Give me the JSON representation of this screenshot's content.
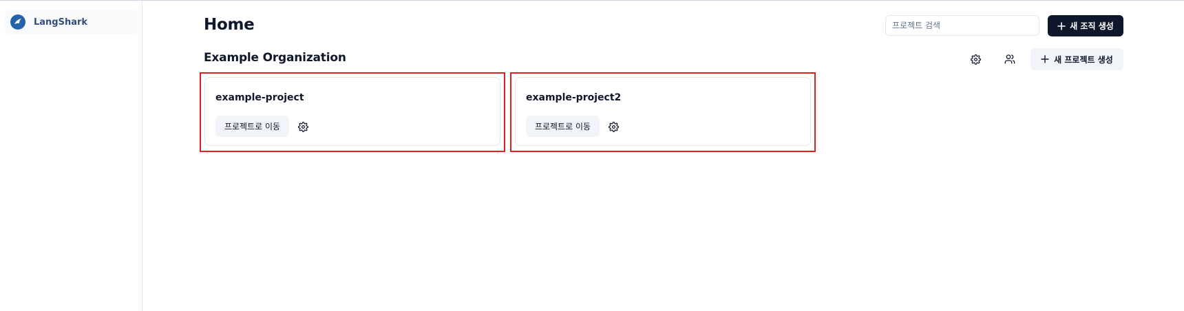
{
  "sidebar": {
    "brand": {
      "name": "LangShark",
      "icon": "shark-logo-icon"
    }
  },
  "header": {
    "title": "Home",
    "search": {
      "placeholder": "프로젝트 검색",
      "value": ""
    },
    "new_org_button": {
      "label": "새 조직 생성",
      "icon": "plus-icon"
    }
  },
  "organization": {
    "name": "Example Organization",
    "actions": {
      "settings_icon": "gear-icon",
      "members_icon": "users-icon",
      "new_project_button": {
        "label": "새 프로젝트 생성",
        "icon": "plus-icon"
      }
    },
    "projects": [
      {
        "name": "example-project",
        "go_label": "프로젝트로 이동",
        "settings_icon": "gear-icon"
      },
      {
        "name": "example-project2",
        "go_label": "프로젝트로 이동",
        "settings_icon": "gear-icon"
      }
    ]
  },
  "colors": {
    "primary": "#0f172a",
    "secondary_bg": "#f1f5f9",
    "brand": "#2563a8",
    "highlight": "#e11d1d",
    "border": "#e2e8f0"
  }
}
